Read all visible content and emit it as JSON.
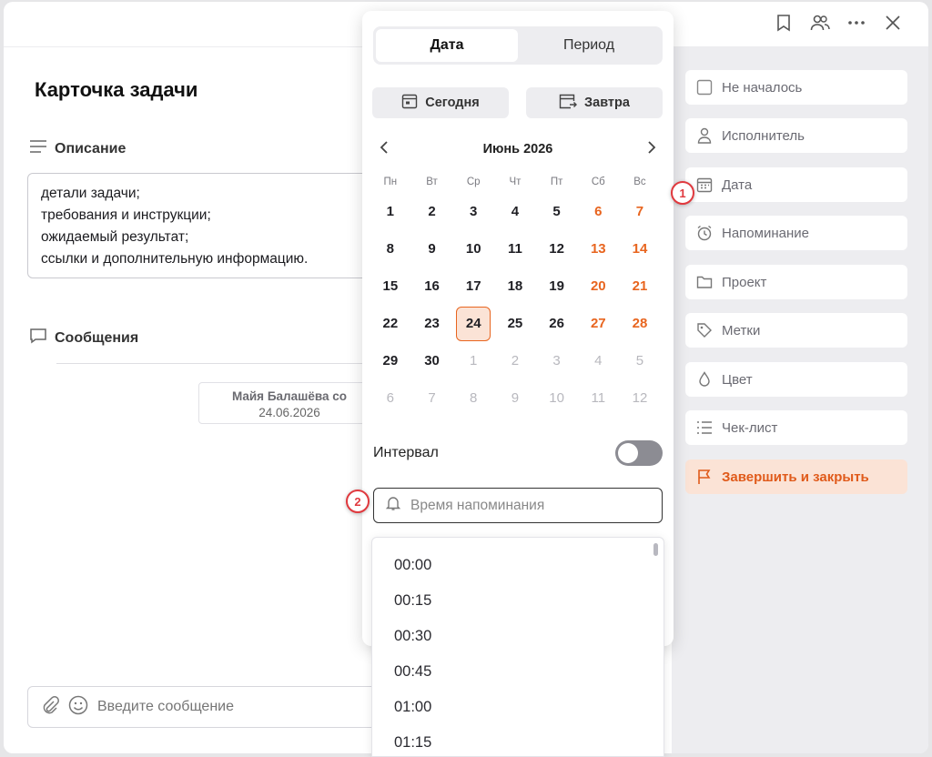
{
  "card": {
    "title": "Карточка задачи",
    "description_label": "Описание",
    "description_lines": [
      "детали задачи;",
      "требования и инструкции;",
      "ожидаемый результат;",
      "ссылки и дополнительную информацию."
    ],
    "messages_label": "Сообщения",
    "message_author": "Майя Балашёва со",
    "message_date": "24.06.2026",
    "compose_placeholder": "Введите сообщение"
  },
  "top_icons": [
    "bookmark-icon",
    "users-icon",
    "more-icon",
    "close-icon"
  ],
  "sidebar": {
    "items": [
      {
        "label": "Не началось",
        "icon": "checkbox-icon"
      },
      {
        "label": "Исполнитель",
        "icon": "user-icon"
      },
      {
        "label": "Дата",
        "icon": "calendar-icon"
      },
      {
        "label": "Напоминание",
        "icon": "alarm-icon"
      },
      {
        "label": "Проект",
        "icon": "folder-icon"
      },
      {
        "label": "Метки",
        "icon": "tag-icon"
      },
      {
        "label": "Цвет",
        "icon": "drop-icon"
      },
      {
        "label": "Чек-лист",
        "icon": "checklist-icon"
      }
    ],
    "finish_label": "Завершить и закрыть"
  },
  "datepicker": {
    "tabs": [
      "Дата",
      "Период"
    ],
    "today_label": "Сегодня",
    "tomorrow_label": "Завтра",
    "month_label": "Июнь 2026",
    "weekdays": [
      "Пн",
      "Вт",
      "Ср",
      "Чт",
      "Пт",
      "Сб",
      "Вс"
    ],
    "weeks": [
      [
        "1",
        "2",
        "3",
        "4",
        "5",
        "6",
        "7"
      ],
      [
        "8",
        "9",
        "10",
        "11",
        "12",
        "13",
        "14"
      ],
      [
        "15",
        "16",
        "17",
        "18",
        "19",
        "20",
        "21"
      ],
      [
        "22",
        "23",
        "24",
        "25",
        "26",
        "27",
        "28"
      ],
      [
        "29",
        "30",
        "1",
        "2",
        "3",
        "4",
        "5"
      ],
      [
        "6",
        "7",
        "8",
        "9",
        "10",
        "11",
        "12"
      ]
    ],
    "selected_day": "24",
    "interval_label": "Интервал",
    "interval_on": false,
    "reminder_placeholder": "Время напоминания",
    "times": [
      "00:00",
      "00:15",
      "00:30",
      "00:45",
      "01:00",
      "01:15"
    ]
  },
  "markers": [
    "1",
    "2"
  ],
  "colors": {
    "accent": "#e8651f",
    "accent_bg": "#fbe3d6",
    "marker": "#e0393e"
  }
}
